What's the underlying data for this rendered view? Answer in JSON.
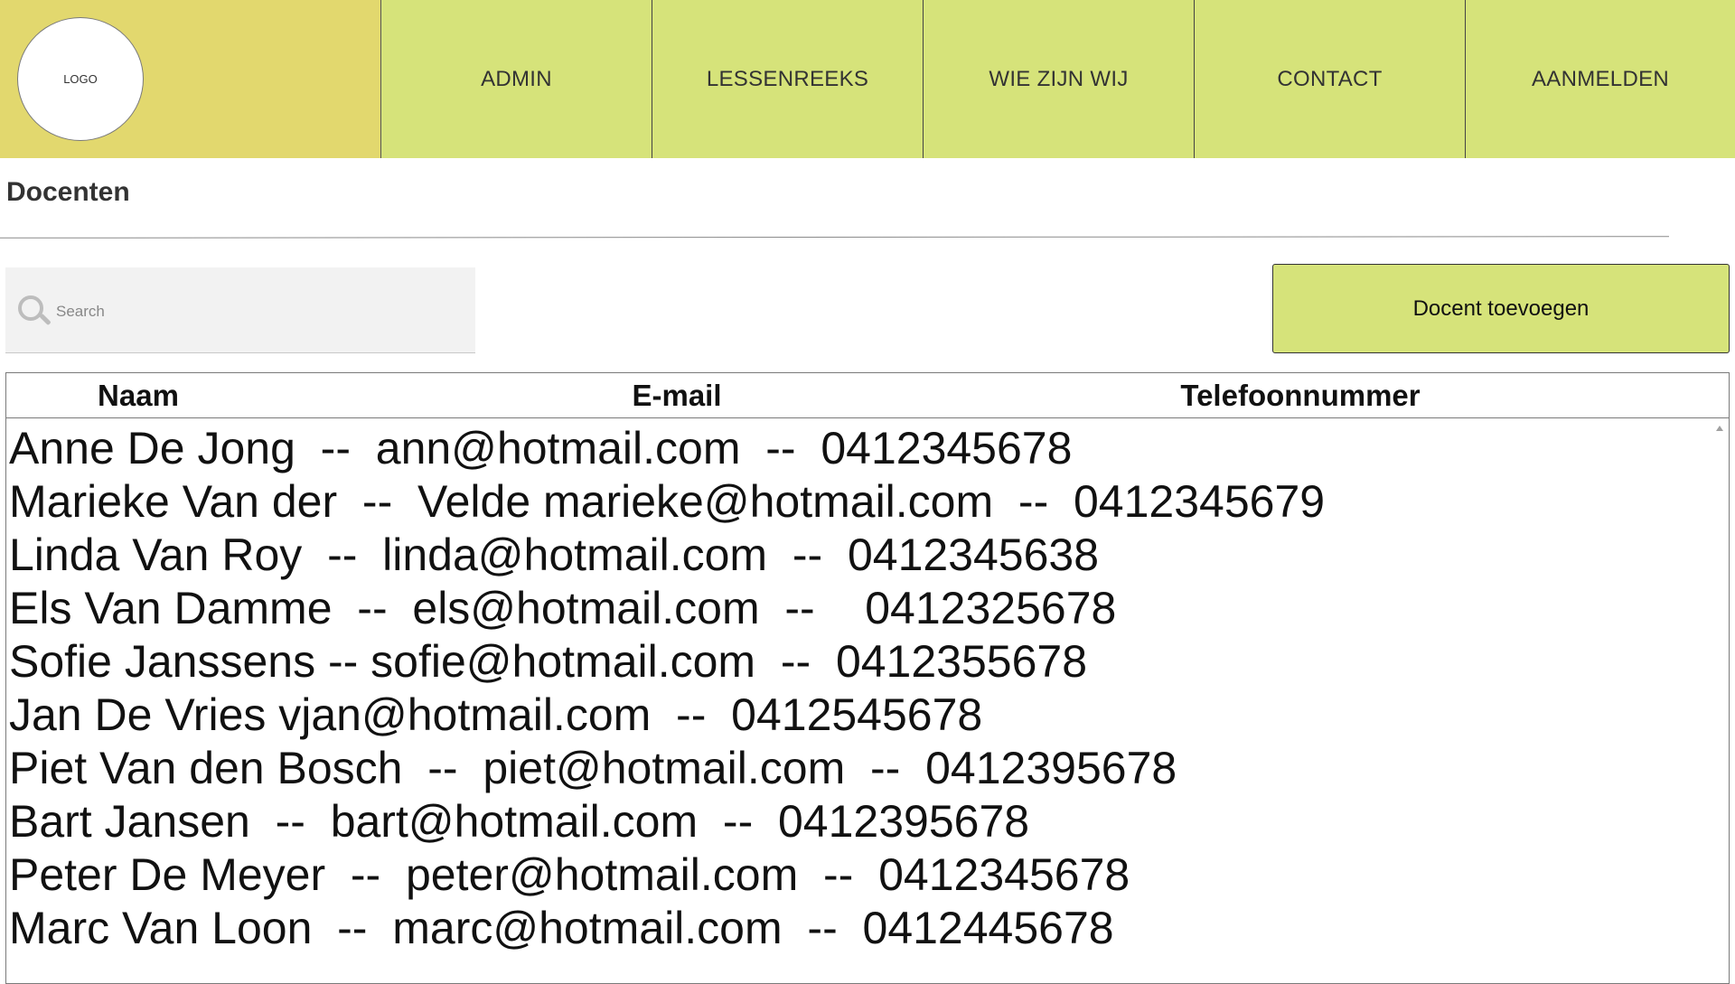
{
  "header": {
    "logo_text": "LOGO",
    "nav": [
      {
        "label": "ADMIN"
      },
      {
        "label": "LESSENREEKS"
      },
      {
        "label": "WIE ZIJN WIJ"
      },
      {
        "label": "CONTACT"
      },
      {
        "label": "AANMELDEN"
      }
    ]
  },
  "page": {
    "title": "Docenten"
  },
  "toolbar": {
    "search_placeholder": "Search",
    "search_value": "",
    "add_button_label": "Docent toevoegen"
  },
  "table": {
    "columns": [
      "Naam",
      "E-mail",
      "Telefoonnummer"
    ],
    "rows": [
      "Anne De Jong  --  ann@hotmail.com  --  0412345678",
      "Marieke Van der  --  Velde marieke@hotmail.com  --  0412345679",
      "Linda Van Roy  --  linda@hotmail.com  --  0412345638",
      "Els Van Damme  --  els@hotmail.com  --    0412325678",
      "Sofie Janssens -- sofie@hotmail.com  --  0412355678",
      "Jan De Vries vjan@hotmail.com  --  0412545678",
      "Piet Van den Bosch  --  piet@hotmail.com  --  0412395678",
      "Bart Jansen  --  bart@hotmail.com  --  0412395678",
      "Peter De Meyer  --  peter@hotmail.com  --  0412345678",
      "Marc Van Loon  --  marc@hotmail.com  --  0412445678"
    ]
  },
  "colors": {
    "logo_bg": "#e2d86e",
    "nav_bg": "#d6e37a",
    "button_bg": "#d6e37a"
  },
  "icons": {
    "search": "search-icon",
    "scroll_up": "scroll-up-arrow-icon"
  }
}
